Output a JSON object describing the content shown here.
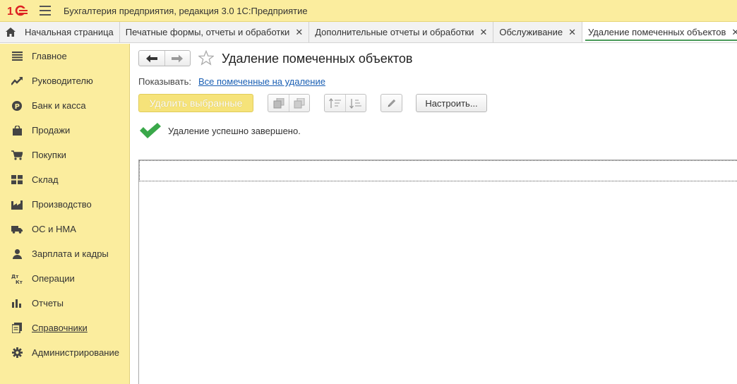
{
  "app": {
    "title": "Бухгалтерия предприятия, редакция 3.0 1С:Предприятие",
    "accent_color": "#fbed9e"
  },
  "tabs": [
    {
      "label": "Начальная страница",
      "icon": "home-icon",
      "closable": false
    },
    {
      "label": "Печатные формы, отчеты и обработки",
      "closable": true
    },
    {
      "label": "Дополнительные отчеты и обработки",
      "closable": true
    },
    {
      "label": "Обслуживание",
      "closable": true
    },
    {
      "label": "Удаление помеченных объектов",
      "closable": true,
      "active": true
    }
  ],
  "tab_close_glyph": "✕",
  "sidebar": {
    "items": [
      {
        "label": "Главное",
        "icon": "list-icon"
      },
      {
        "label": "Руководителю",
        "icon": "trend-icon"
      },
      {
        "label": "Банк и касса",
        "icon": "ruble-icon"
      },
      {
        "label": "Продажи",
        "icon": "bag-icon"
      },
      {
        "label": "Покупки",
        "icon": "cart-icon"
      },
      {
        "label": "Склад",
        "icon": "warehouse-icon"
      },
      {
        "label": "Производство",
        "icon": "factory-icon"
      },
      {
        "label": "ОС и НМА",
        "icon": "truck-icon"
      },
      {
        "label": "Зарплата и кадры",
        "icon": "person-icon"
      },
      {
        "label": "Операции",
        "icon": "dt-kt-icon"
      },
      {
        "label": "Отчеты",
        "icon": "bar-chart-icon"
      },
      {
        "label": "Справочники",
        "icon": "book-icon"
      },
      {
        "label": "Администрирование",
        "icon": "gear-icon"
      }
    ]
  },
  "page": {
    "title": "Удаление помеченных объектов",
    "show_label": "Показывать:",
    "show_link": "Все помеченные на удаление",
    "delete_button": "Удалить выбранные",
    "setup_button": "Настроить...",
    "status_message": "Удаление успешно завершено.",
    "status_color": "#3aa84a"
  }
}
